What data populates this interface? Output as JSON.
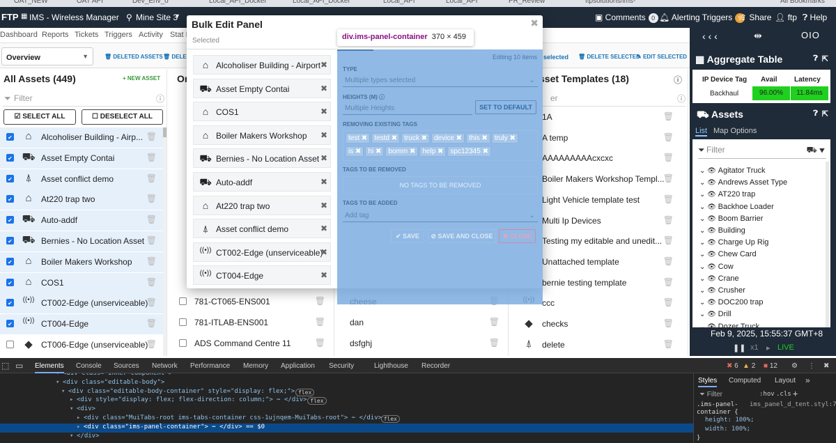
{
  "bookmarks": [
    "OAT_NEW",
    "OAT API",
    "Dev_Env_o",
    "Local_API_Docker",
    "Local_API_Docker",
    "Local_API",
    "Local_API",
    "PR_Review",
    "ftpsolutions/ims-",
    "All Bookmarks"
  ],
  "topnav": {
    "logo": "FTP",
    "app": "IMS - Wireless Manager",
    "site": "Mine Site 3",
    "comments": "Comments",
    "comments_count": "0",
    "alerting": "Alerting Triggers",
    "alerting_count": "9",
    "share": "Share",
    "user": "ftp",
    "help": "Help"
  },
  "subnav": [
    "Dashboard",
    "Reports",
    "Tickets",
    "Triggers",
    "Activity",
    "Stat E"
  ],
  "toolbar": {
    "overview": "Overview",
    "deleted_assets": "DELETED ASSETS",
    "dele": "DELE",
    "selected": "selected",
    "delete_selected": "DELETE SELECTED",
    "edit_selected": "EDIT SELECTED"
  },
  "all_assets": {
    "title": "All Assets (449)",
    "new_asset": "+ NEW ASSET",
    "filter": "Filter",
    "select_all": "SELECT ALL",
    "deselect_all": "DESELECT ALL",
    "items": [
      {
        "label": "Alcoholiser Building - Airp...",
        "icon": "building-icon",
        "g": "⌂",
        "checked": true
      },
      {
        "label": "Asset Empty Contai",
        "icon": "loader-icon",
        "g": "⛟",
        "checked": true
      },
      {
        "label": "Asset conflict demo",
        "icon": "tower-icon",
        "g": "⍋",
        "checked": true
      },
      {
        "label": "At220 trap two",
        "icon": "building-icon",
        "g": "⌂",
        "checked": true
      },
      {
        "label": "Auto-addf",
        "icon": "truck-icon",
        "g": "⛟",
        "checked": true
      },
      {
        "label": "Bernies - No Location Asset",
        "icon": "truck-icon",
        "g": "⛟",
        "checked": true
      },
      {
        "label": "Boiler Makers Workshop",
        "icon": "shed-icon",
        "g": "⌂",
        "checked": true
      },
      {
        "label": "COS1",
        "icon": "shed-icon",
        "g": "⌂",
        "checked": true
      },
      {
        "label": "CT002-Edge (unserviceable)",
        "icon": "signal-icon",
        "g": "((•))",
        "checked": true
      },
      {
        "label": "CT004-Edge",
        "icon": "signal-icon",
        "g": "((•))",
        "checked": true
      },
      {
        "label": "CT006-Edge (unserviceable)",
        "icon": "diamond-icon",
        "g": "◆",
        "checked": false
      }
    ]
  },
  "col2": {
    "title": "Or",
    "items": [
      "781-CT065-ENS001",
      "781-ITLAB-ENS001",
      "ADS Command Centre 11"
    ]
  },
  "col3": {
    "items": [
      "cheese",
      "dan",
      "dsfghj"
    ]
  },
  "templates": {
    "title": "sset Templates (18)",
    "filter": "er",
    "items": [
      {
        "label": "1A",
        "g": ""
      },
      {
        "label": "A temp",
        "g": ""
      },
      {
        "label": "AAAAAAAAAcxcxc",
        "g": ""
      },
      {
        "label": "Boiler Makers Workshop Templ...",
        "g": ""
      },
      {
        "label": "Light Vehicle template test",
        "g": ""
      },
      {
        "label": "Multi Ip Devices",
        "g": ""
      },
      {
        "label": "Testing my editable and unedit...",
        "g": ""
      },
      {
        "label": "Unattached template",
        "g": ""
      },
      {
        "label": "bernie testing template",
        "g": ""
      },
      {
        "label": "ccc",
        "g": "((•))"
      },
      {
        "label": "checks",
        "g": "◆"
      },
      {
        "label": "delete",
        "g": "⍋"
      }
    ]
  },
  "modal": {
    "title": "Bulk Edit Panel",
    "selected": "Selected",
    "items": [
      {
        "label": "Alcoholiser Building - Airport",
        "g": "⌂"
      },
      {
        "label": "Asset Empty Contai",
        "g": "⛟"
      },
      {
        "label": "COS1",
        "g": "⌂"
      },
      {
        "label": "Boiler Makers Workshop",
        "g": "⌂"
      },
      {
        "label": "Bernies - No Location Asset",
        "g": "⛟"
      },
      {
        "label": "Auto-addf",
        "g": "⛟"
      },
      {
        "label": "At220 trap two",
        "g": "⌂"
      },
      {
        "label": "Asset conflict demo",
        "g": "⍋"
      },
      {
        "label": "CT002-Edge (unserviceable)",
        "g": "((•))"
      },
      {
        "label": "CT004-Edge",
        "g": "((•))"
      }
    ]
  },
  "panel": {
    "editing": "Editing 10 items",
    "type_label": "TYPE",
    "type_placeholder": "Multiple types selected",
    "heights_label": "HEIGHTS (M)",
    "heights_placeholder": "Multiple Heights",
    "set_default": "SET TO DEFAULT",
    "removing_label": "REMOVING EXISTING TAGS",
    "tags": [
      "test",
      "testd",
      "truck",
      "device",
      "this",
      "truly",
      "is",
      "hi",
      "bomm",
      "help",
      "spc12345"
    ],
    "tbr_label": "TAGS TO BE REMOVED",
    "no_tags": "NO TAGS TO BE REMOVED",
    "tba_label": "TAGS TO BE ADDED",
    "add_tag": "Add tag",
    "save": "✔ SAVE",
    "save_close": "⊘ SAVE AND CLOSE",
    "close": "✖ CLOSE"
  },
  "tooltip": {
    "selector": "div.ims-panel-container",
    "size": "370 × 459"
  },
  "right": {
    "agg_title": "Aggregate Table",
    "col_tag": "IP Device Tag",
    "col_avail": "Avail",
    "col_latency": "Latency",
    "row_tag": "Backhaul",
    "row_avail": "96.00%",
    "row_latency": "11.84ms",
    "assets_title": "Assets",
    "tab_list": "List",
    "tab_map": "Map Options",
    "filter": "Filter",
    "tree": [
      "Agitator Truck",
      "Andrews Asset Type",
      "AT220 trap",
      "Backhoe Loader",
      "Boom Barrier",
      "Building",
      "Charge Up Rig",
      "Chew Card",
      "Cow",
      "Crane",
      "Crusher",
      "DOC200 trap",
      "Drill",
      "Dozer Truck"
    ],
    "timestamp": "Feb 9, 2025, 15:55:37 GMT+8",
    "speed": "x1",
    "live": "LIVE"
  },
  "devtools": {
    "tabs": [
      "Elements",
      "Console",
      "Sources",
      "Network",
      "Performance",
      "Memory",
      "Application",
      "Security",
      "Lighthouse",
      "Recorder"
    ],
    "errors": "6",
    "warnings": "2",
    "issues": "12",
    "styles_tabs": [
      "Styles",
      "Computed",
      "Layout"
    ],
    "filter": "Filter",
    "hov": ":hov",
    "cls": ".cls",
    "css_selector": ".ims-panel-container {",
    "css_file": "ims_panel_d_tent.styl:7",
    "css_h": "height: 100%;",
    "css_w": "width: 100%;",
    "css_end": "}",
    "lines": [
      {
        "t": "<div class=\"inner-component\">"
      },
      {
        "t": "<div class=\"editable-body\">"
      },
      {
        "t": "<div class=\"editable-body-container\" style=\"display: flex;\">",
        "flex": true
      },
      {
        "t": "<div style=\"display: flex; flex-direction: column;\"> ⋯ </div>",
        "flex": true
      },
      {
        "t": "<div>"
      },
      {
        "t": "<div class=\"MuiTabs-root ims-tabs-container css-1ujnqem-MuiTabs-root\"> ⋯ </div>",
        "flex": true
      },
      {
        "t": "<div class=\"ims-panel-container\"> ⋯ </div> == $0",
        "sel": true
      },
      {
        "t": "</div>"
      }
    ]
  }
}
